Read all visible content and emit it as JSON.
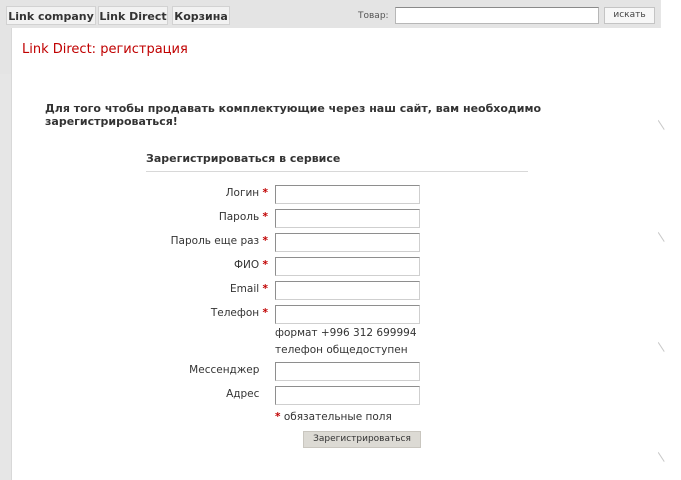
{
  "nav": {
    "tabs": [
      {
        "label": "Link company"
      },
      {
        "label": "Link Direct"
      },
      {
        "label": "Корзина"
      }
    ],
    "search": {
      "label": "Товар:",
      "value": "",
      "button_label": "искать"
    }
  },
  "page": {
    "title": "Link Direct: регистрация",
    "intro": "Для того чтобы продавать комплектующие через наш сайт, вам необходимо зарегистрироваться!"
  },
  "form": {
    "title": "Зарегистрироваться в сервисе",
    "required_marker": "*",
    "fields": [
      {
        "label": "Логин",
        "value": ""
      },
      {
        "label": "Пароль",
        "value": ""
      },
      {
        "label": "Пароль еще раз",
        "value": ""
      },
      {
        "label": "ФИО",
        "value": ""
      },
      {
        "label": "Email",
        "value": ""
      },
      {
        "label": "Телефон",
        "value": ""
      },
      {
        "label": "Мессенджер",
        "value": ""
      },
      {
        "label": "Адрес",
        "value": ""
      }
    ],
    "phone_hint_1": "формат +996 312 699994",
    "phone_hint_2": "телефон общедоступен",
    "required_note": "обязательные поля",
    "submit_label": "Зарегистрироваться"
  },
  "colors": {
    "accent_red": "#c00000",
    "background": "#e6e6e6"
  }
}
